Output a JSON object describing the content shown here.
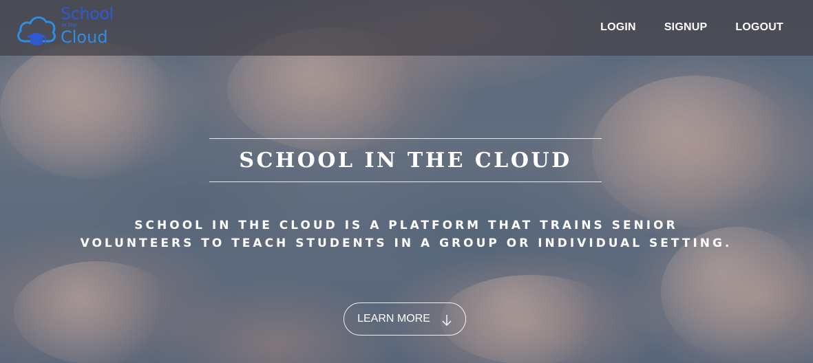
{
  "brand": {
    "logo_line1": "School",
    "logo_line2": "in the",
    "logo_line3": "Cloud",
    "logo_icon": "cloud-graduation-cap-icon",
    "color": "#2e59cf"
  },
  "nav": {
    "items": [
      {
        "label": "LOGIN"
      },
      {
        "label": "SIGNUP"
      },
      {
        "label": "LOGOUT"
      }
    ]
  },
  "hero": {
    "title": "SCHOOL IN THE CLOUD",
    "description": "SCHOOL IN THE CLOUD IS A PLATFORM THAT TRAINS SENIOR VOLUNTEERS TO TEACH STUDENTS IN A GROUP OR INDIVIDUAL SETTING.",
    "cta_label": "LEARN MORE",
    "cta_icon": "arrow-down-icon"
  }
}
